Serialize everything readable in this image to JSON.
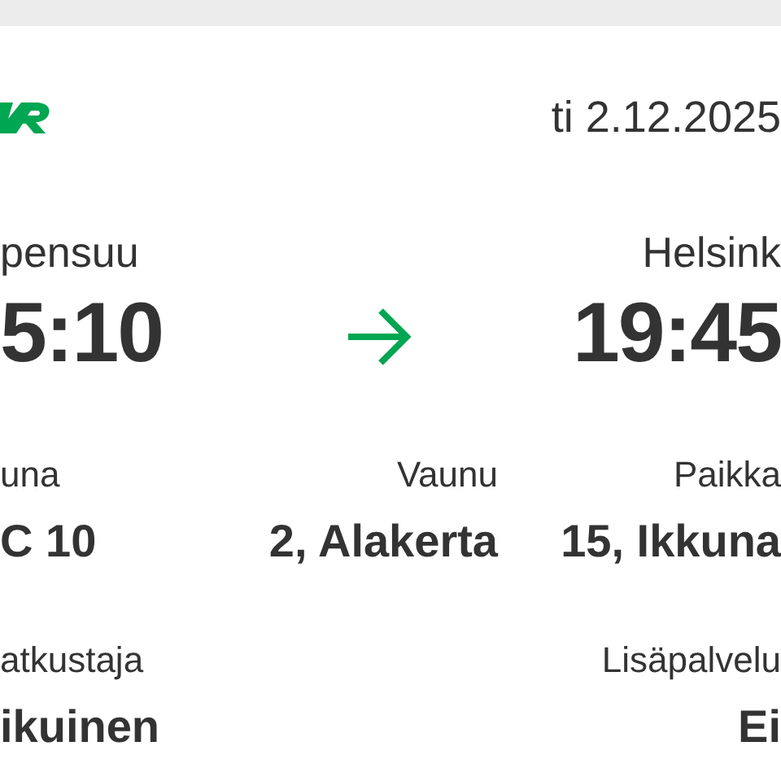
{
  "header": {
    "date": "ti 2.12.2025"
  },
  "route": {
    "origin": {
      "station": "pensuu",
      "time": "5:10"
    },
    "destination": {
      "station": "Helsink",
      "time": "19:45"
    }
  },
  "detail_rows": [
    [
      {
        "kind": "left",
        "label": "una",
        "value": "C 10"
      },
      {
        "kind": "middle",
        "label": "Vaunu",
        "value": "2, Alakerta"
      },
      {
        "kind": "right",
        "label": "Paikka",
        "value": "15, Ikkuna"
      }
    ],
    [
      {
        "kind": "left",
        "label": "atkustaja",
        "value": "ikuinen"
      },
      {
        "kind": "right",
        "label": "Lisäpalvelu",
        "value": "Ei"
      }
    ]
  ]
}
